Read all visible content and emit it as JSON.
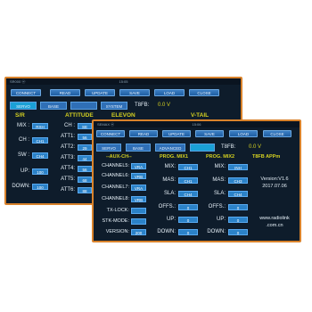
{
  "back_window": {
    "statusbar": {
      "left": "SR000 ⓦ",
      "mid": "15:05",
      "right": ""
    },
    "toolbar": [
      "CONNECT",
      "READ",
      "UPDATE",
      "SAVE",
      "LOAD",
      "CLOSE"
    ],
    "tabs": [
      "SERVO",
      "BASE",
      "",
      "SYSTEM"
    ],
    "t8fb": {
      "label": "T8FB:",
      "value": "0.0 V"
    },
    "section_headers": {
      "sr": "S/R",
      "attitude": "ATTITUDE",
      "elevon": "ELEVON",
      "vtail": "V-TAIL"
    },
    "left_rows": [
      {
        "label": "MIX :",
        "value": "RXH"
      },
      {
        "label": "CH :",
        "value": "CH1"
      },
      {
        "label": "SW :",
        "value": "CH4"
      },
      {
        "label": "UP:",
        "value": "100"
      },
      {
        "label": "DOWN:",
        "value": "100"
      }
    ],
    "right_rows": [
      {
        "label": "CH :",
        "value": "SE"
      },
      {
        "label": "ATT1:",
        "value": "56"
      },
      {
        "label": "ATT2:",
        "value": "29"
      },
      {
        "label": "ATT3:",
        "value": "44"
      },
      {
        "label": "ATT4:",
        "value": "56"
      },
      {
        "label": "ATT5:",
        "value": "68"
      },
      {
        "label": "ATT6:",
        "value": "88"
      }
    ]
  },
  "front_window": {
    "statusbar": {
      "left": "SEMAX ⓦ",
      "mid": "15:06",
      "right": ""
    },
    "toolbar": [
      "CONNECT",
      "READ",
      "UPDATE",
      "SAVE",
      "LOAD",
      "CLOSE"
    ],
    "tabs": [
      "SERVO",
      "BASE",
      "ADVANCED",
      ""
    ],
    "t8fb": {
      "label": "T8FB:",
      "value": "0.0 V"
    },
    "section_headers": {
      "aux": "--AUX-CH--",
      "mix1": "PROG. MIX1",
      "mix2": "PROG. MIX2",
      "app": "T8FB APPm"
    },
    "aux_rows": [
      {
        "label": "CHANNEL5:",
        "value": "VRA"
      },
      {
        "label": "CHANNEL6:",
        "value": "VRB"
      },
      {
        "label": "CHANNEL7:",
        "value": "VRA"
      },
      {
        "label": "CHANNEL8:",
        "value": "VRB"
      },
      {
        "label": "TX-LOCK:",
        "value": ""
      },
      {
        "label": "STK-MODE:",
        "value": ""
      },
      {
        "label": "VERSION:",
        "value": "200"
      }
    ],
    "mix1_rows": [
      {
        "label": "MIX:",
        "value": "CH1"
      },
      {
        "label": "MAS:",
        "value": "CH1"
      },
      {
        "label": "SLA:",
        "value": "CH4"
      },
      {
        "label": "OFFS.:",
        "value": "0"
      },
      {
        "label": "UP:",
        "value": "0"
      },
      {
        "label": "DOWN:",
        "value": "0"
      }
    ],
    "mix2_rows": [
      {
        "label": "MIX:",
        "value": "INH"
      },
      {
        "label": "MAS:",
        "value": "CH3"
      },
      {
        "label": "SLA:",
        "value": "CH4"
      },
      {
        "label": "OFFS.:",
        "value": "0"
      },
      {
        "label": "UP:",
        "value": "0"
      },
      {
        "label": "DOWN:",
        "value": "0"
      }
    ],
    "app_info": {
      "version": "Version:V1.6",
      "date": "2017.07.06",
      "url1": "www.radiolink",
      "url2": ".com.cn"
    }
  }
}
